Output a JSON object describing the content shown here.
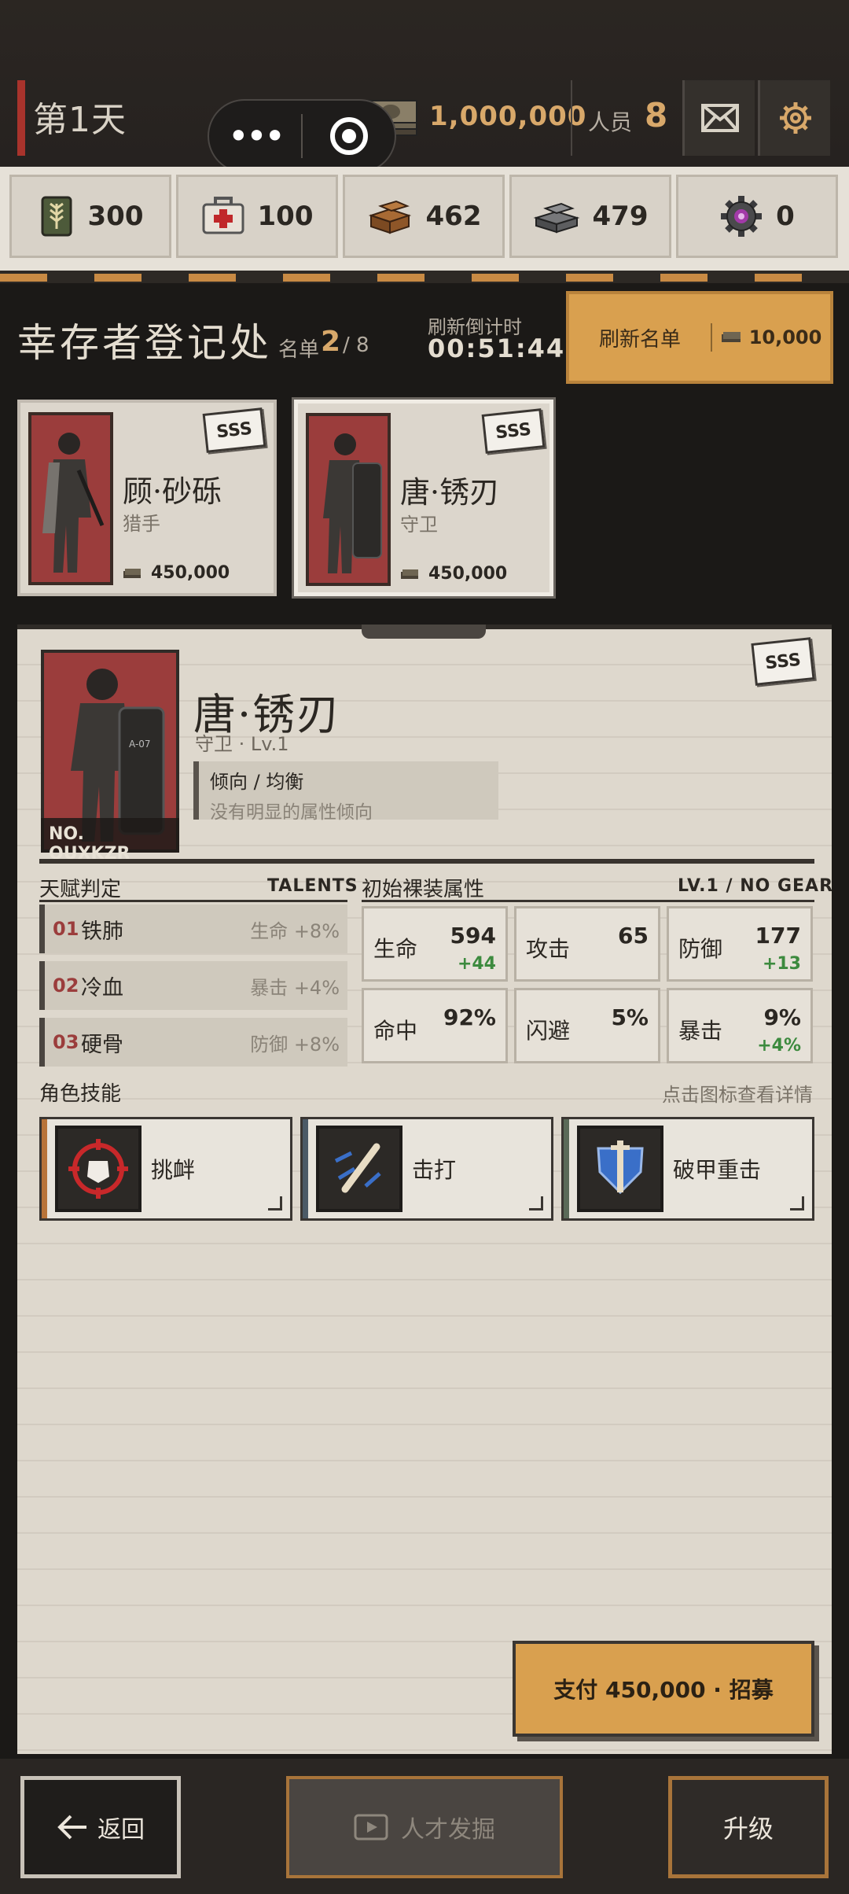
{
  "header": {
    "day": "第1天",
    "cash": "1,000,000",
    "staff_label": "人员",
    "staff_count": "8"
  },
  "resources": [
    {
      "name": "food-icon",
      "value": "300"
    },
    {
      "name": "medkit-icon",
      "value": "100"
    },
    {
      "name": "wood-icon",
      "value": "462"
    },
    {
      "name": "steel-icon",
      "value": "479"
    },
    {
      "name": "gear-part-icon",
      "value": "0"
    }
  ],
  "registry": {
    "title": "幸存者登记处",
    "list_label": "名单",
    "list_current": "2",
    "list_total": "/ 8",
    "timer_label": "刷新倒计时",
    "timer": "00:51:44",
    "refresh_label": "刷新名单",
    "refresh_cost": "10,000"
  },
  "candidates": [
    {
      "name": "顾·砂砾",
      "role": "猎手",
      "price": "450,000",
      "rank": "SSS"
    },
    {
      "name": "唐·锈刃",
      "role": "守卫",
      "price": "450,000",
      "rank": "SSS"
    }
  ],
  "detail": {
    "name": "唐·锈刃",
    "sub": "守卫 · Lv.1",
    "rank": "SSS",
    "serial": "NO. OUXKZR",
    "tendency_title": "倾向 /  均衡",
    "tendency_desc": "没有明显的属性倾向",
    "talents_title": "天赋判定",
    "talents_tag": "TALENTS",
    "talents": [
      {
        "num": "01",
        "name": "铁肺",
        "effect": "生命 +8%"
      },
      {
        "num": "02",
        "name": "冷血",
        "effect": "暴击 +4%"
      },
      {
        "num": "03",
        "name": "硬骨",
        "effect": "防御 +8%"
      }
    ],
    "stats_title": "初始裸装属性",
    "stats_tag": "LV.1 / NO GEAR",
    "stats": [
      {
        "label": "生命",
        "value": "594",
        "bonus": "+44"
      },
      {
        "label": "攻击",
        "value": "65",
        "bonus": ""
      },
      {
        "label": "防御",
        "value": "177",
        "bonus": "+13"
      },
      {
        "label": "命中",
        "value": "92%",
        "bonus": ""
      },
      {
        "label": "闪避",
        "value": "5%",
        "bonus": ""
      },
      {
        "label": "暴击",
        "value": "9%",
        "bonus": "+4%"
      }
    ],
    "skills_title": "角色技能",
    "skills_hint": "点击图标查看详情",
    "skills": [
      {
        "name": "挑衅",
        "icon": "taunt-icon",
        "bar": "#b8743a"
      },
      {
        "name": "击打",
        "icon": "strike-icon",
        "bar": "#4b5a66"
      },
      {
        "name": "破甲重击",
        "icon": "armor-break-icon",
        "bar": "#5a6a58"
      }
    ],
    "pay_label": "支付 450,000 · 招募"
  },
  "nav": {
    "back": "返回",
    "talent": "人才发掘",
    "upgrade": "升级"
  }
}
